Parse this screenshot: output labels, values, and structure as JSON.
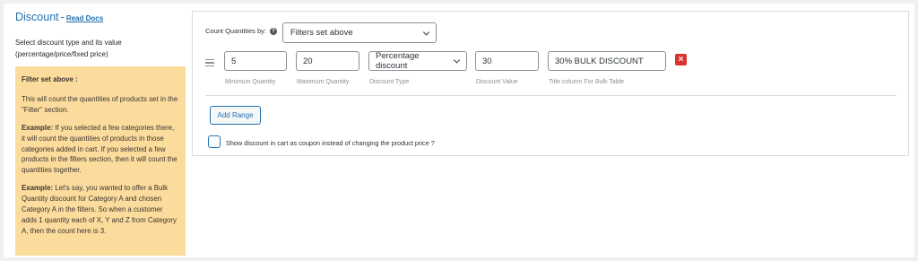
{
  "left": {
    "title": "Discount",
    "dash": "-",
    "read_docs": "Read Docs",
    "description": "Select discount type and its value (percentage/price/fixed price)",
    "note": {
      "heading": "Filter set above :",
      "p1": "This will count the quantities of products set in the \"Filter\" section.",
      "ex1_label": "Example:",
      "ex1_text": " If you selected a few categories there, it will count the quantities of products in those categories added in cart. If you selected a few products in the filters section, then it will count the quantities together.",
      "ex2_label": "Example:",
      "ex2_text": " Let's say, you wanted to offer a Bulk Quantity discount for Category A and chosen Category A in the filters. So when a customer adds 1 quantity each of X, Y and Z from Category A, then the count here is 3."
    }
  },
  "panel": {
    "count_label": "Count Quantities by:",
    "help_icon": "?",
    "count_value": "Filters set above",
    "range": {
      "min_value": "5",
      "max_value": "20",
      "type_value": "Percentage discount",
      "discount_value": "30",
      "title_value": "30% BULK DISCOUNT",
      "min_label": "Minimum Quantity",
      "max_label": "Maximum Quantity",
      "type_label": "Discount Type",
      "discount_label": "Discount Value",
      "title_label": "Title column For Bulk Table",
      "remove_symbol": "×"
    },
    "add_range": "Add Range",
    "coupon_label": "Show discount in cart as coupon instead of changing the product price ?"
  },
  "colors": {
    "accent": "#2271b1",
    "note_bg": "#fcdc9c",
    "remove": "#dc3232"
  },
  "icons": [
    "help-icon",
    "drag-handle-icon",
    "chevron-down-icon",
    "close-icon"
  ]
}
